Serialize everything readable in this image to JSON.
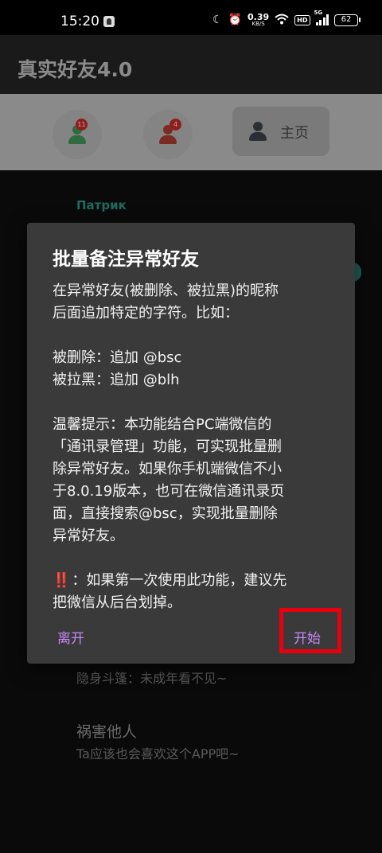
{
  "status_bar": {
    "time": "15:20",
    "net_speed_value": "0.39",
    "net_speed_unit": "KB/S",
    "hd_label": "HD",
    "signal_label": "5G",
    "battery": "62"
  },
  "app": {
    "title": "真实好友4.0"
  },
  "tabs": {
    "tab1_badge": "11",
    "tab2_badge": "4",
    "home_label": "主页"
  },
  "list": {
    "section_label": "Патрик",
    "item_sub_1": "隐身斗篷：未成年看不见~",
    "item_title_2": "祸害他人",
    "item_sub_2": "Ta应该也会喜欢这个APP吧~"
  },
  "dialog": {
    "title": "批量备注异常好友",
    "line1": "在异常好友(被删除、被拉黑)的昵称",
    "line2": "后面追加特定的字符。比如：",
    "line3": "被删除：追加 @bsc",
    "line4": "被拉黑：追加 @blh",
    "line5": "温馨提示：本功能结合PC端微信的",
    "line6": "「通讯录管理」功能，可实现批量删",
    "line7": "除异常好友。如果你手机端微信不小",
    "line8": "于8.0.19版本，也可在微信通讯录页",
    "line9": "面，直接搜索@bsc，实现批量删除",
    "line10": "异常好友。",
    "warn_icon": "‼️",
    "line11": "：如果第一次使用此功能，建议先",
    "line12": "把微信从后台划掉。",
    "leave_button": "离开",
    "start_button": "开始"
  },
  "colors": {
    "accent": "#c586f5",
    "highlight": "#e8000e",
    "dialog_bg": "#3a3a3a"
  }
}
